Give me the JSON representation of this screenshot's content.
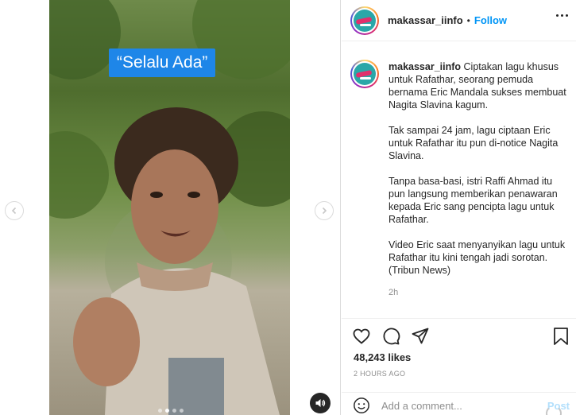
{
  "video": {
    "overlay_text": "“Selalu Ada”",
    "carousel_dots": 4,
    "active_dot": 1
  },
  "post": {
    "username": "makassar_iinfo",
    "follow_label": "Follow",
    "separator": "•",
    "caption_paragraphs": [
      "Ciptakan lagu khusus untuk Rafathar, seorang pemuda bernama Eric Mandala sukses membuat Nagita Slavina kagum.",
      "Tak sampai 24 jam, lagu ciptaan Eric untuk Rafathar itu pun di-notice Nagita Slavina.",
      "Tanpa basa-basi, istri Raffi Ahmad itu pun langsung memberikan penawaran kepada Eric sang pencipta lagu untuk Rafathar.",
      "Video Eric saat menyanyikan lagu untuk Rafathar itu kini tengah jadi sorotan. (Tribun News)"
    ],
    "caption_time": "2h",
    "likes": "48,243 likes",
    "posted_ago": "2 HOURS AGO"
  },
  "comment_box": {
    "placeholder": "Add a comment...",
    "post_label": "Post"
  },
  "colors": {
    "accent": "#0095f6",
    "overlay_label_bg": "#1e86e8",
    "muted_text": "#8e8e8e"
  },
  "icons": [
    "chevron-left-icon",
    "chevron-right-icon",
    "speaker-icon",
    "more-icon",
    "heart-icon",
    "comment-icon",
    "share-icon",
    "bookmark-icon",
    "emoji-icon"
  ]
}
